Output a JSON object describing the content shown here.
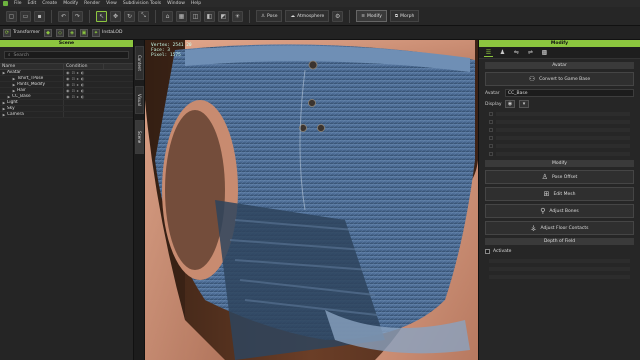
{
  "menu": [
    "File",
    "Edit",
    "Create",
    "Modify",
    "Render",
    "View",
    "Subdivision Tools",
    "Window",
    "Help"
  ],
  "toolbar": {
    "pose": "Pose",
    "atmosphere": "Atmosphere",
    "modify": "Modify",
    "morph": "Morph"
  },
  "subbar": {
    "transformer": "Transformer",
    "instalod": "InstaLOD"
  },
  "scene": {
    "title": "Scene",
    "search_placeholder": "Search",
    "col_name": "Name",
    "col_condition": "Condition",
    "rows": [
      {
        "label": "Avatar",
        "indent": 0
      },
      {
        "label": "Tshirt_TPose",
        "indent": 2
      },
      {
        "label": "Pants_Modify",
        "indent": 2
      },
      {
        "label": "Hair",
        "indent": 2
      },
      {
        "label": "CC_Base",
        "indent": 1
      },
      {
        "label": "Light",
        "indent": 0
      },
      {
        "label": "Sky",
        "indent": 0
      },
      {
        "label": "Camera",
        "indent": 0
      }
    ]
  },
  "side_tabs": [
    "Content",
    "Visual",
    "Scene"
  ],
  "viewport": {
    "overlay": [
      "Vertex: 2541 20",
      "Face: 3",
      "Pixel: 1575"
    ]
  },
  "modify": {
    "title": "Modify",
    "avatar_section": "Avatar",
    "convert_btn": "Convert to Game Base",
    "avatar_label": "Avatar",
    "avatar_value": "CC_Base",
    "display_label": "Display",
    "modify_section": "Modify",
    "actions": [
      "Pose Offset",
      "Edit Mesh",
      "Adjust Bones",
      "Adjust Floor Contacts"
    ],
    "dof_section": "Depth of Field",
    "activate_label": "Activate"
  },
  "colors": {
    "accent": "#8cc63f",
    "panel_bg": "#262626",
    "viewport_bg": "#5a3524"
  }
}
